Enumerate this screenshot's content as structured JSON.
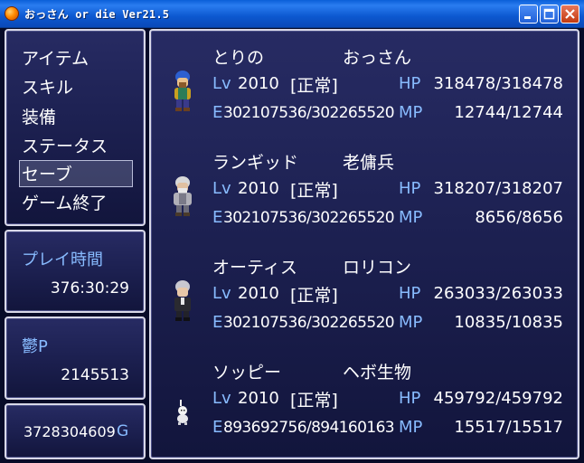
{
  "window": {
    "title": "おっさん or die Ver21.5",
    "minimize_label": "minimize",
    "maximize_label": "maximize",
    "close_label": "close"
  },
  "menu": {
    "items": [
      "アイテム",
      "スキル",
      "装備",
      "ステータス",
      "セーブ",
      "ゲーム終了"
    ],
    "selected_index": 4
  },
  "playtime": {
    "label": "プレイ時間",
    "value": "376:30:29"
  },
  "points": {
    "label": "鬱P",
    "value": "2145513"
  },
  "gold": {
    "value": "3728304609",
    "unit": "G"
  },
  "party": [
    {
      "name": "とりの",
      "class": "おっさん",
      "lv_label": "Lv",
      "lv": "2010",
      "state": "[正常]",
      "hp_label": "HP",
      "hp": "318478/318478",
      "e_label": "E",
      "exp": "302107536/302265520",
      "mp_label": "MP",
      "mp": "12744/12744"
    },
    {
      "name": "ランギッド",
      "class": "老傭兵",
      "lv_label": "Lv",
      "lv": "2010",
      "state": "[正常]",
      "hp_label": "HP",
      "hp": "318207/318207",
      "e_label": "E",
      "exp": "302107536/302265520",
      "mp_label": "MP",
      "mp": "8656/8656"
    },
    {
      "name": "オーティス",
      "class": "ロリコン",
      "lv_label": "Lv",
      "lv": "2010",
      "state": "[正常]",
      "hp_label": "HP",
      "hp": "263033/263033",
      "e_label": "E",
      "exp": "302107536/302265520",
      "mp_label": "MP",
      "mp": "10835/10835"
    },
    {
      "name": "ソッピー",
      "class": "ヘボ生物",
      "lv_label": "Lv",
      "lv": "2010",
      "state": "[正常]",
      "hp_label": "HP",
      "hp": "459792/459792",
      "e_label": "E",
      "exp": "893692756/894160163",
      "mp_label": "MP",
      "mp": "15517/15517"
    }
  ],
  "colors": {
    "system_text": "#88bbff",
    "window_bg": "#1d2152",
    "border": "#d8d8e8"
  }
}
